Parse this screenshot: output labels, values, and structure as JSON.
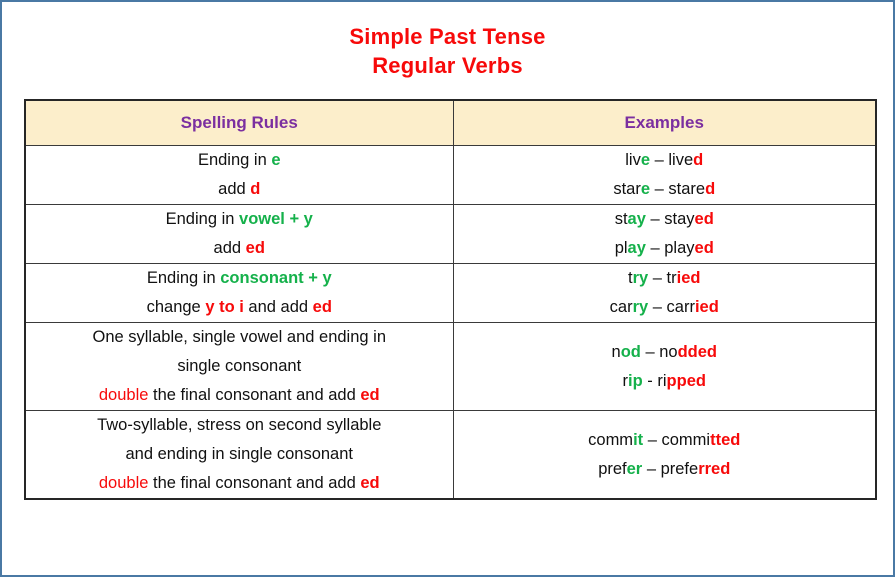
{
  "colors": {
    "title": "#f70a0a",
    "header_text": "#7b2fa0",
    "header_bg": "#fceecb",
    "green": "#15b14b",
    "red": "#f70a0a",
    "outer_border": "#4a79a4",
    "body_text": "#111111"
  },
  "title": {
    "line1": "Simple Past Tense",
    "line2": "Regular Verbs"
  },
  "table": {
    "headers": {
      "rules": "Spelling Rules",
      "examples": "Examples"
    },
    "rows": [
      {
        "rule_lines": [
          [
            {
              "t": "Ending in ",
              "s": "plain"
            },
            {
              "t": "e",
              "s": "green"
            }
          ],
          [
            {
              "t": "add ",
              "s": "plain"
            },
            {
              "t": "d",
              "s": "red-bold"
            }
          ]
        ],
        "example_lines": [
          [
            {
              "t": "liv",
              "s": "plain"
            },
            {
              "t": "e",
              "s": "green"
            },
            {
              "t": " – live",
              "s": "plain"
            },
            {
              "t": "d",
              "s": "red-bold"
            }
          ],
          [
            {
              "t": "star",
              "s": "plain"
            },
            {
              "t": "e",
              "s": "green"
            },
            {
              "t": " – stare",
              "s": "plain"
            },
            {
              "t": "d",
              "s": "red-bold"
            }
          ]
        ],
        "rule_text": "Ending in e / add d",
        "example_text": "live – lived / stare – stared"
      },
      {
        "rule_lines": [
          [
            {
              "t": "Ending in ",
              "s": "plain"
            },
            {
              "t": "vowel + y",
              "s": "green"
            }
          ],
          [
            {
              "t": "add ",
              "s": "plain"
            },
            {
              "t": "ed",
              "s": "red-bold"
            }
          ]
        ],
        "example_lines": [
          [
            {
              "t": "st",
              "s": "plain"
            },
            {
              "t": "ay",
              "s": "green"
            },
            {
              "t": " – stay",
              "s": "plain"
            },
            {
              "t": "ed",
              "s": "red-bold"
            }
          ],
          [
            {
              "t": "pl",
              "s": "plain"
            },
            {
              "t": "ay",
              "s": "green"
            },
            {
              "t": " – play",
              "s": "plain"
            },
            {
              "t": "ed",
              "s": "red-bold"
            }
          ]
        ],
        "rule_text": "Ending in vowel + y / add ed",
        "example_text": "stay – stayed / play – played"
      },
      {
        "rule_lines": [
          [
            {
              "t": "Ending in ",
              "s": "plain"
            },
            {
              "t": "consonant + y",
              "s": "green"
            }
          ],
          [
            {
              "t": "change ",
              "s": "plain"
            },
            {
              "t": "y to i",
              "s": "red-bold"
            },
            {
              "t": " and add ",
              "s": "plain"
            },
            {
              "t": "ed",
              "s": "red-bold"
            }
          ]
        ],
        "example_lines": [
          [
            {
              "t": "t",
              "s": "plain"
            },
            {
              "t": "ry",
              "s": "green"
            },
            {
              "t": " – tr",
              "s": "plain"
            },
            {
              "t": "ied",
              "s": "red-bold"
            }
          ],
          [
            {
              "t": "car",
              "s": "plain"
            },
            {
              "t": "ry",
              "s": "green"
            },
            {
              "t": " – carr",
              "s": "plain"
            },
            {
              "t": "ied",
              "s": "red-bold"
            }
          ]
        ],
        "rule_text": "Ending in consonant + y / change y to i and add ed",
        "example_text": "try – tried / carry – carried"
      },
      {
        "rule_lines": [
          [
            {
              "t": "One syllable, single vowel and ending in",
              "s": "plain"
            }
          ],
          [
            {
              "t": "single consonant",
              "s": "plain"
            }
          ],
          [
            {
              "t": "double",
              "s": "red"
            },
            {
              "t": " the final consonant and add ",
              "s": "plain"
            },
            {
              "t": "ed",
              "s": "red-bold"
            }
          ]
        ],
        "example_lines": [
          [
            {
              "t": "n",
              "s": "plain"
            },
            {
              "t": "od",
              "s": "green"
            },
            {
              "t": " – no",
              "s": "plain"
            },
            {
              "t": "dded",
              "s": "red-bold"
            }
          ],
          [
            {
              "t": "r",
              "s": "plain"
            },
            {
              "t": "ip",
              "s": "green"
            },
            {
              "t": " - ri",
              "s": "plain"
            },
            {
              "t": "pped",
              "s": "red-bold"
            }
          ]
        ],
        "rule_text": "One syllable, single vowel and ending in single consonant / double the final consonant and add ed",
        "example_text": "nod – nodded / rip - ripped"
      },
      {
        "rule_lines": [
          [
            {
              "t": "Two-syllable, stress on second syllable",
              "s": "plain"
            }
          ],
          [
            {
              "t": "and ending in single consonant",
              "s": "plain"
            }
          ],
          [
            {
              "t": "double",
              "s": "red"
            },
            {
              "t": " the final consonant and add ",
              "s": "plain"
            },
            {
              "t": "ed",
              "s": "red-bold"
            }
          ]
        ],
        "example_lines": [
          [
            {
              "t": "comm",
              "s": "plain"
            },
            {
              "t": "it",
              "s": "green"
            },
            {
              "t": " – commi",
              "s": "plain"
            },
            {
              "t": "tted",
              "s": "red-bold"
            }
          ],
          [
            {
              "t": "pref",
              "s": "plain"
            },
            {
              "t": "er",
              "s": "green"
            },
            {
              "t": " – prefe",
              "s": "plain"
            },
            {
              "t": "rred",
              "s": "red-bold"
            }
          ]
        ],
        "rule_text": "Two-syllable, stress on second syllable and ending in single consonant / double the final consonant and add ed",
        "example_text": "commit – committed / prefer – preferred"
      }
    ]
  }
}
